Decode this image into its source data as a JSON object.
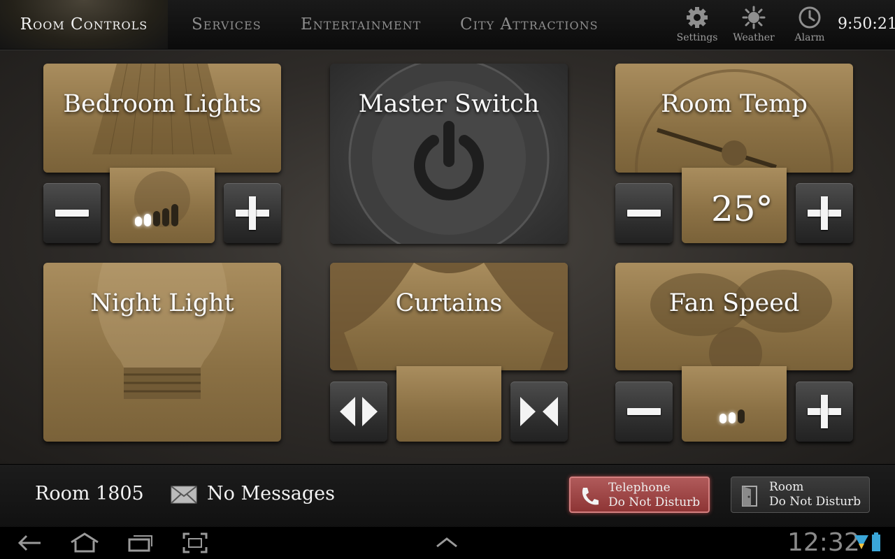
{
  "tabs": [
    {
      "label": "Room Controls",
      "active": true
    },
    {
      "label": "Services",
      "active": false
    },
    {
      "label": "Entertainment",
      "active": false
    },
    {
      "label": "City Attractions",
      "active": false
    }
  ],
  "top_actions": {
    "settings": {
      "label": "Settings",
      "icon": "gear-icon"
    },
    "weather": {
      "label": "Weather",
      "icon": "sun-icon"
    },
    "alarm": {
      "label": "Alarm",
      "icon": "clock-icon"
    }
  },
  "clock": "9:50:21",
  "tiles": {
    "bedroom_lights": {
      "title": "Bedroom Lights",
      "level": 2,
      "level_max": 5
    },
    "master_switch": {
      "title": "Master Switch",
      "icon": "power-icon"
    },
    "room_temp": {
      "title": "Room Temp",
      "value": "25°"
    },
    "night_light": {
      "title": "Night Light"
    },
    "curtains": {
      "title": "Curtains"
    },
    "fan_speed": {
      "title": "Fan Speed",
      "level": 2,
      "level_max": 3
    }
  },
  "status": {
    "room": "Room 1805",
    "messages": "No Messages",
    "telephone_dnd": {
      "line1": "Telephone",
      "line2": "Do Not Disturb",
      "active": true
    },
    "room_dnd": {
      "line1": "Room",
      "line2": "Do Not Disturb",
      "active": false
    }
  },
  "system": {
    "time": "12:32"
  },
  "colors": {
    "accent_sepia": "#9a7f50",
    "dnd_active": "#9e4545"
  }
}
